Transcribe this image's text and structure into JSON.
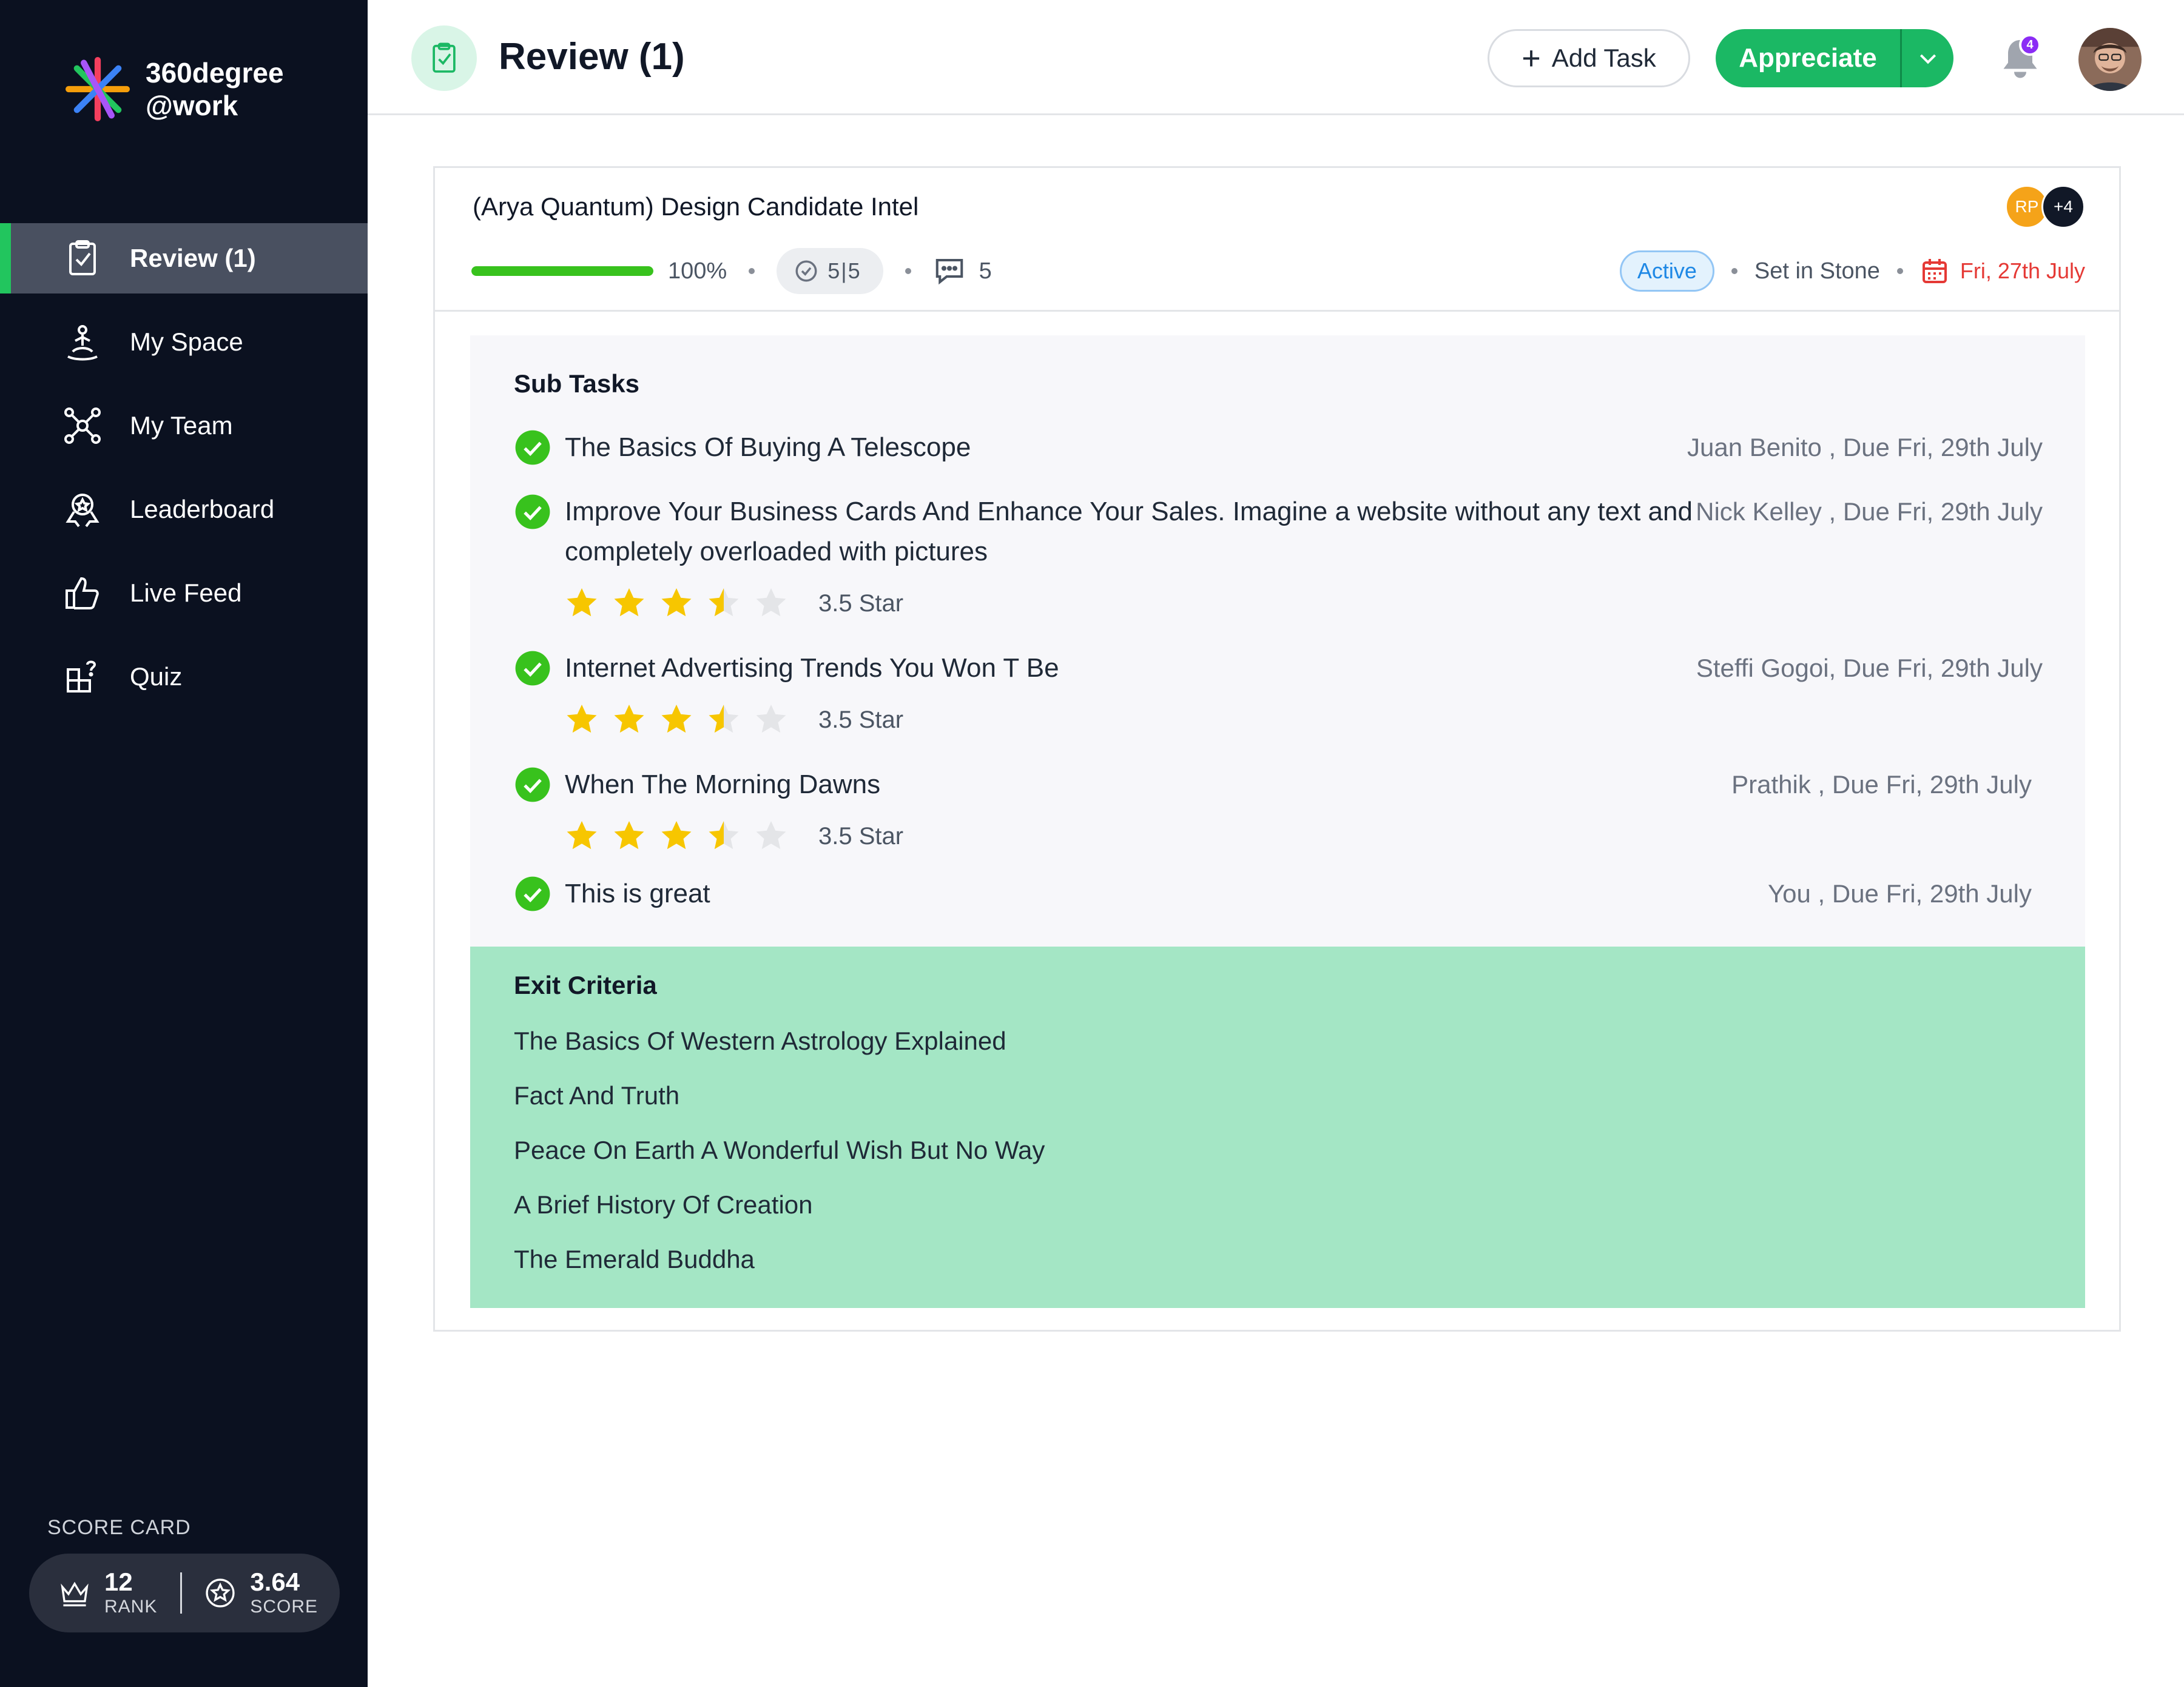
{
  "brand": {
    "line1": "360degree",
    "line2": "@work"
  },
  "sidebar": {
    "items": [
      {
        "label": "Review (1)",
        "icon": "clipboard-check-icon",
        "active": true
      },
      {
        "label": "My Space",
        "icon": "meditation-icon",
        "active": false
      },
      {
        "label": "My Team",
        "icon": "team-network-icon",
        "active": false
      },
      {
        "label": "Leaderboard",
        "icon": "award-icon",
        "active": false
      },
      {
        "label": "Live Feed",
        "icon": "thumbs-up-icon",
        "active": false
      },
      {
        "label": "Quiz",
        "icon": "quiz-icon",
        "active": false
      }
    ],
    "score_card": {
      "label": "SCORE CARD",
      "rank_value": "12",
      "rank_label": "RANK",
      "score_value": "3.64",
      "score_label": "SCORE"
    }
  },
  "header": {
    "title": "Review (1)",
    "add_task_label": "Add Task",
    "appreciate_label": "Appreciate",
    "notification_count": "4"
  },
  "task": {
    "title": "(Arya Quantum) Design Candidate Intel",
    "progress_percent": 100,
    "progress_label": "100%",
    "checklist_count": "5|5",
    "comment_count": "5",
    "status": "Active",
    "category": "Set in Stone",
    "due_date": "Fri, 27th July",
    "assignees": {
      "initials": "RP",
      "more": "+4"
    },
    "colors": {
      "accent": "#1bb864",
      "progress": "#38c21d",
      "due": "#e53935",
      "status": "#1e88e5",
      "exit_bg": "#a4e6c5"
    }
  },
  "subtasks": {
    "title": "Sub Tasks",
    "items": [
      {
        "text": "The Basics Of Buying A Telescope",
        "assignee": "Juan Benito , Due Fri, 29th July",
        "rating": null,
        "rating_label": ""
      },
      {
        "text": "Improve Your Business Cards And Enhance Your Sales. Imagine a website without any text and completely overloaded with pictures",
        "assignee": "Nick Kelley , Due Fri, 29th July",
        "rating": 3.5,
        "rating_label": "3.5 Star"
      },
      {
        "text": "Internet Advertising Trends You Won T Be",
        "assignee": "Steffi Gogoi, Due Fri, 29th July",
        "rating": 3.5,
        "rating_label": "3.5 Star"
      },
      {
        "text": "When The Morning Dawns",
        "assignee": "Prathik , Due Fri, 29th July",
        "rating": 3.5,
        "rating_label": "3.5 Star"
      },
      {
        "text": "This is great",
        "assignee": "You , Due Fri, 29th July",
        "rating": null,
        "rating_label": ""
      }
    ]
  },
  "exit_criteria": {
    "title": "Exit Criteria",
    "items": [
      "The Basics Of Western Astrology Explained",
      "Fact And Truth",
      "Peace On Earth A Wonderful Wish But No Way",
      "A Brief History Of Creation",
      "The Emerald Buddha"
    ]
  }
}
